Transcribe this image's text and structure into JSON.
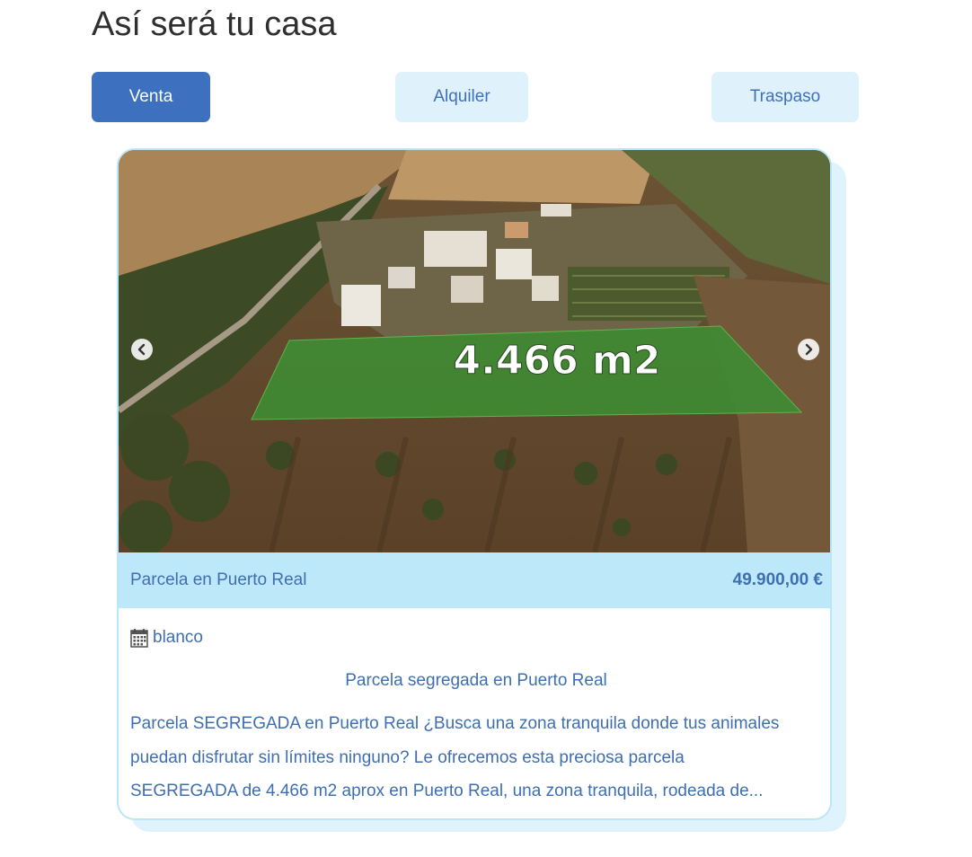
{
  "page": {
    "title": "Así será tu casa"
  },
  "tabs": [
    {
      "label": "Venta",
      "active": true
    },
    {
      "label": "Alquiler",
      "active": false
    },
    {
      "label": "Traspaso",
      "active": false
    }
  ],
  "listing": {
    "image_overlay_text": "4.466 m2",
    "title": "Parcela en Puerto Real",
    "price": "49.900,00 €",
    "meta_text": "blanco",
    "meta_icon": "calendar-icon",
    "headline": "Parcela segregada en Puerto Real",
    "description_lines": [
      "Parcela SEGREGADA en Puerto Real ¿Busca una zona tranquila donde tus animales",
      "puedan disfrutar sin límites ninguno? Le ofrecemos esta preciosa parcela",
      "SEGREGADA de 4.466 m2 aprox en Puerto Real, una zona tranquila, rodeada de..."
    ]
  },
  "carousel": {
    "prev_icon": "chevron-left-icon",
    "next_icon": "chevron-right-icon"
  },
  "colors": {
    "primary": "#3e70c0",
    "tab_inactive_bg": "#dff2fc",
    "info_bar_bg": "#bde8fa",
    "text_blue": "#3e6eb3"
  }
}
